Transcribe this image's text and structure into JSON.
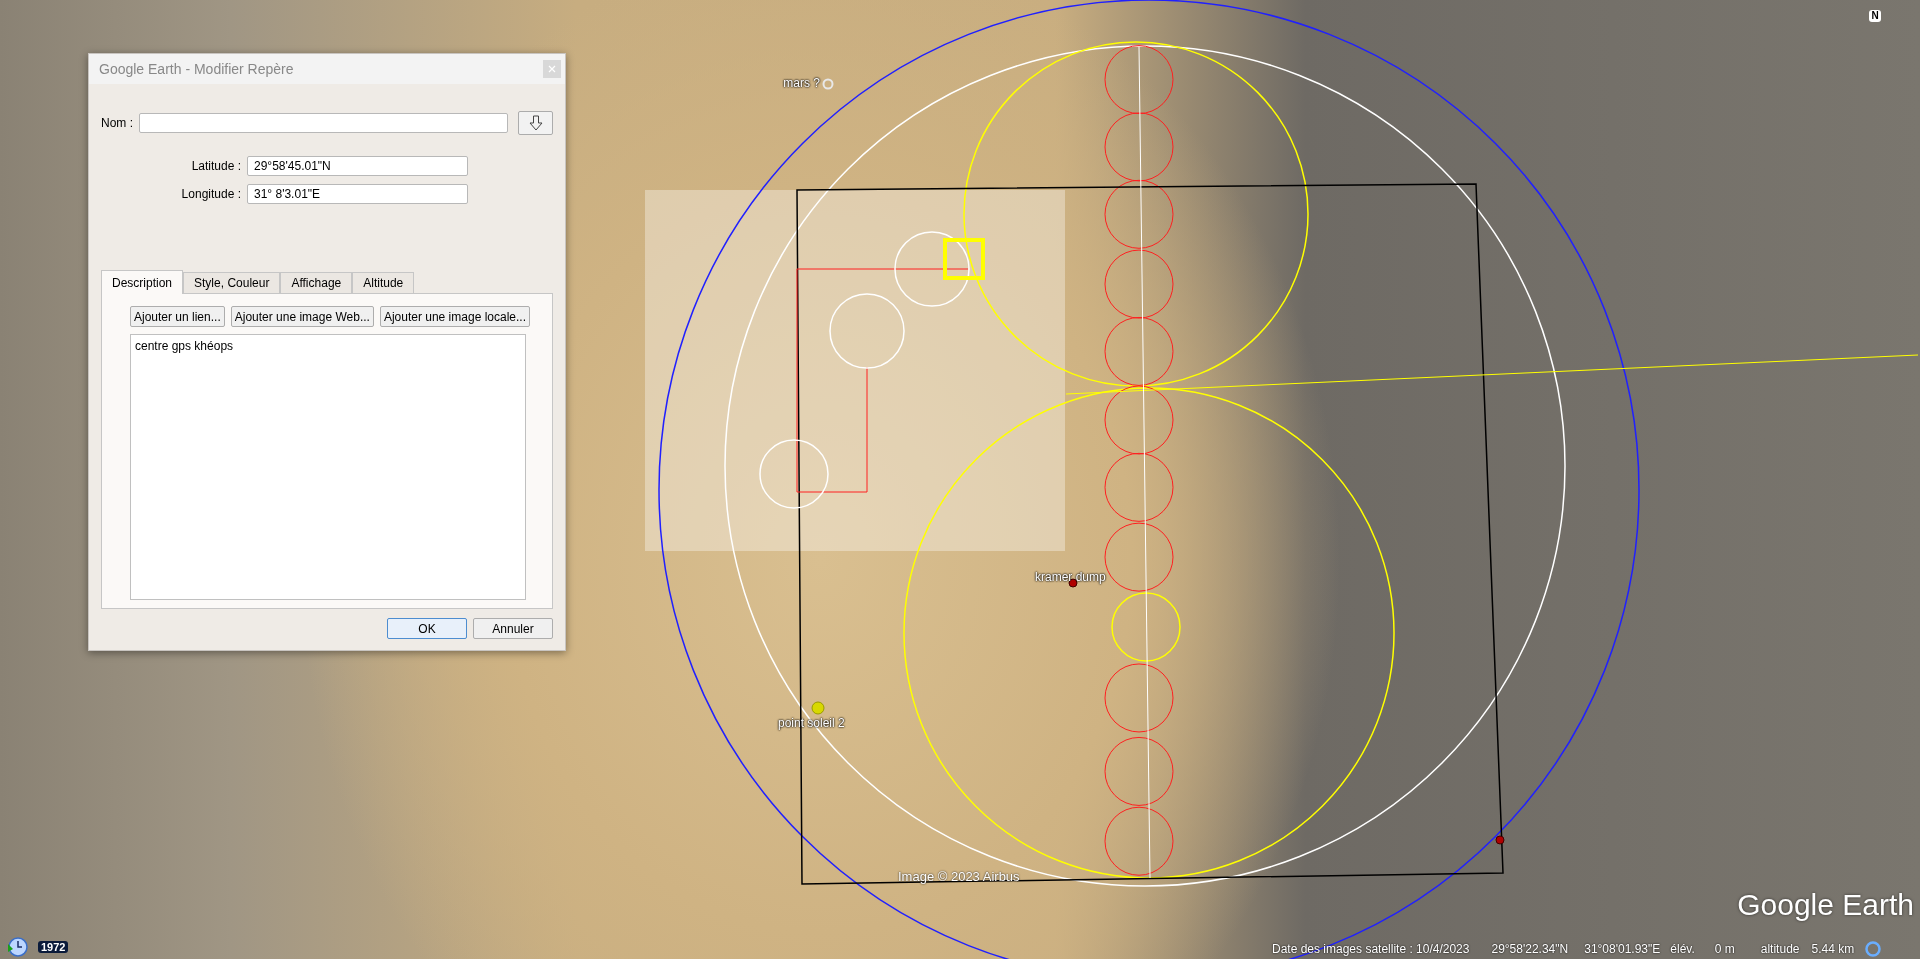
{
  "dialog": {
    "title": "Google Earth - Modifier Repère",
    "name_field": {
      "label": "Nom :"
    },
    "latitude": {
      "label": "Latitude :",
      "value": "29°58'45.01\"N"
    },
    "longitude": {
      "label": "Longitude :",
      "value": "31° 8'3.01\"E"
    },
    "tabs": [
      {
        "label": "Description",
        "selected": true
      },
      {
        "label": "Style, Couleur",
        "selected": false
      },
      {
        "label": "Affichage",
        "selected": false
      },
      {
        "label": "Altitude",
        "selected": false
      }
    ],
    "insert_buttons": [
      "Ajouter un lien...",
      "Ajouter une image Web...",
      "Ajouter une image locale..."
    ],
    "description": "centre gps khéops",
    "actions": [
      {
        "label": "OK",
        "default": true
      },
      {
        "label": "Annuler",
        "default": false
      }
    ]
  },
  "map": {
    "placemarks": [
      {
        "kind": "ring",
        "label": "mars ?"
      },
      {
        "kind": "red-dot",
        "label": "kramer dump"
      },
      {
        "kind": "yellow-dot",
        "label": "point soleil 2"
      },
      {
        "kind": "red-dot"
      }
    ],
    "attribution": "Image © 2023 Airbus",
    "compass": "N",
    "timeline_year": "1972",
    "logo": "Google Earth"
  },
  "status_bar": {
    "imagery_date": "Date des images satellite : 10/4/2023",
    "latitude": "29°58'22.34\"N",
    "longitude": "31°08'01.93\"E",
    "elevation_label": "élév.",
    "elevation": "0 m",
    "altitude_label": "altitude",
    "altitude": "5.44 km"
  }
}
